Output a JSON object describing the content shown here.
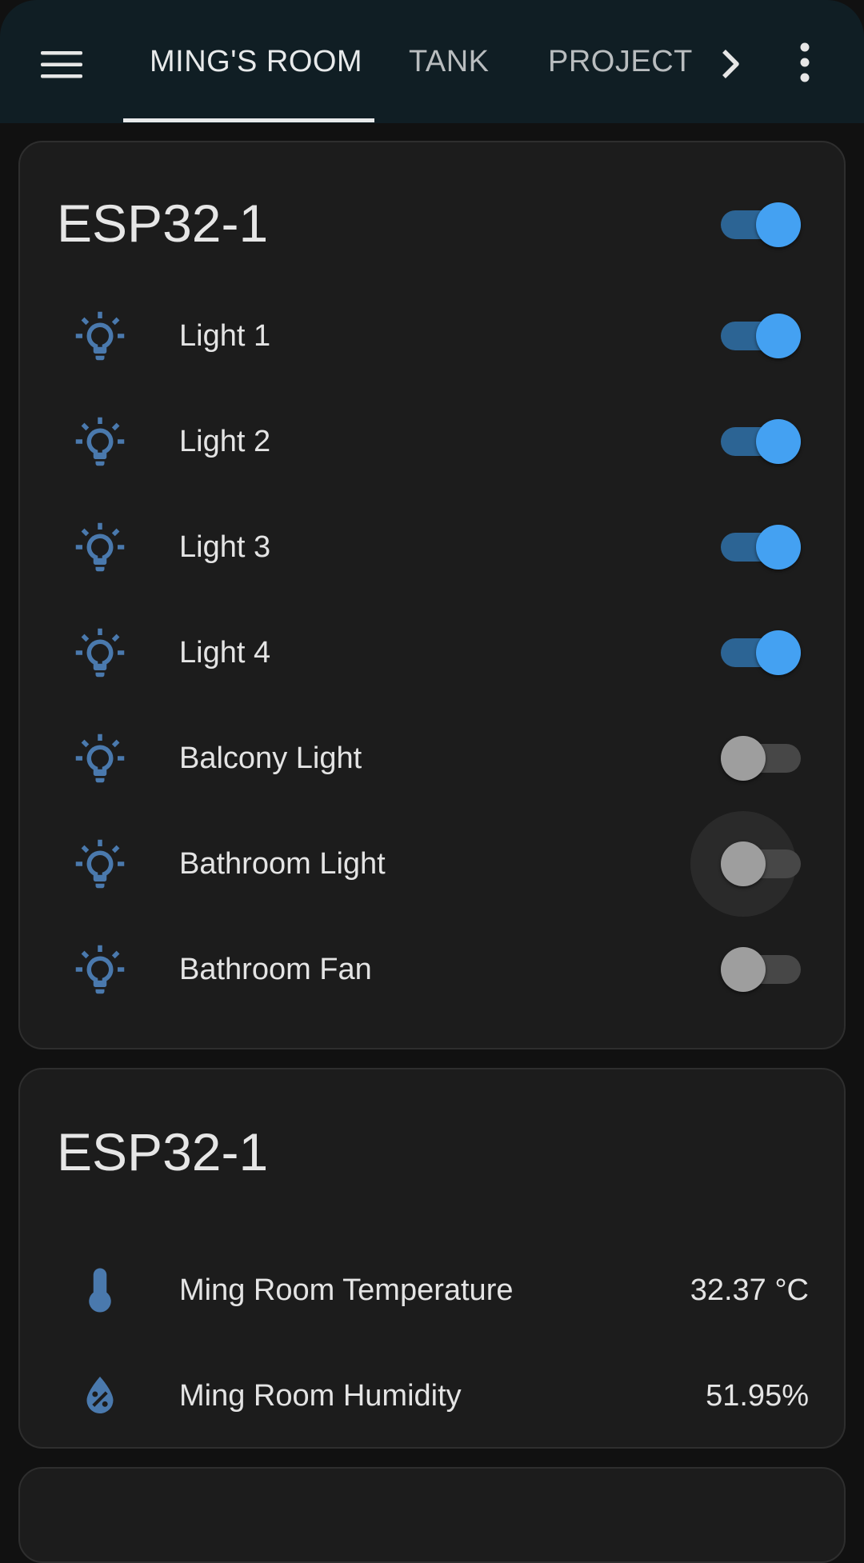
{
  "colors": {
    "accent": "#44a1f2",
    "icon": "#4a79ad",
    "background": "#111111",
    "card": "#1c1c1c",
    "toolbar": "#101e24"
  },
  "toolbar": {
    "menu_icon": "menu-icon",
    "tabs": [
      {
        "label": "MING'S ROOM",
        "active": true
      },
      {
        "label": "TANK",
        "active": false
      },
      {
        "label": "PROJECT",
        "active": false
      }
    ],
    "scroll_icon": "chevron-right-icon",
    "overflow_icon": "more-vertical-icon"
  },
  "cards": [
    {
      "title": "ESP32-1",
      "master_toggle": true,
      "entities": [
        {
          "name": "Light 1",
          "icon": "lightbulb-icon",
          "state": true
        },
        {
          "name": "Light 2",
          "icon": "lightbulb-icon",
          "state": true
        },
        {
          "name": "Light 3",
          "icon": "lightbulb-icon",
          "state": true
        },
        {
          "name": "Light 4",
          "icon": "lightbulb-icon",
          "state": true
        },
        {
          "name": "Balcony Light",
          "icon": "lightbulb-icon",
          "state": false
        },
        {
          "name": "Bathroom Light",
          "icon": "lightbulb-icon",
          "state": false
        },
        {
          "name": "Bathroom Fan",
          "icon": "lightbulb-icon",
          "state": false
        }
      ]
    },
    {
      "title": "ESP32-1",
      "sensors": [
        {
          "name": "Ming Room Temperature",
          "icon": "thermometer-icon",
          "value": "32.37 °C"
        },
        {
          "name": "Ming Room Humidity",
          "icon": "water-percent-icon",
          "value": "51.95%"
        }
      ]
    }
  ]
}
